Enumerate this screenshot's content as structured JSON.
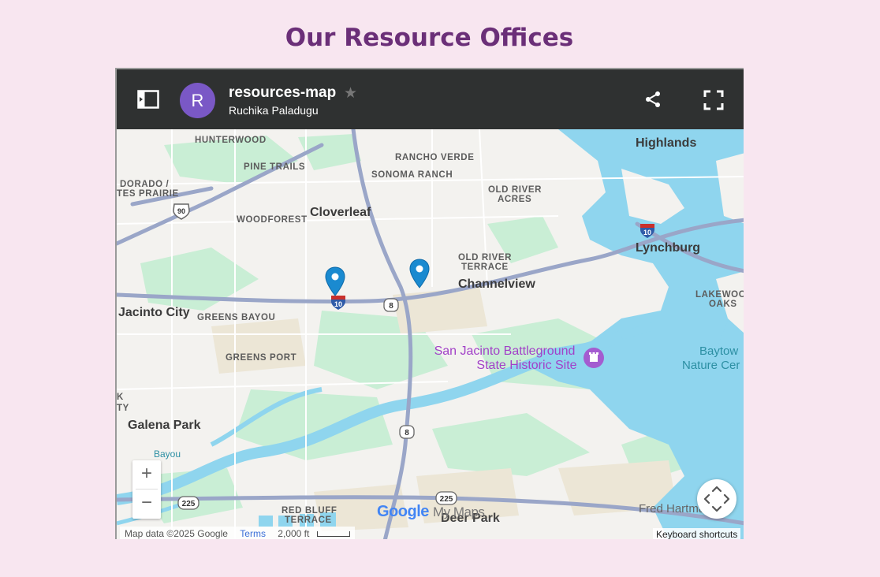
{
  "page": {
    "title": "Our Resource Offices"
  },
  "map_header": {
    "map_name": "resources-map",
    "owner": "Ruchika Paladugu",
    "avatar_letter": "R",
    "avatar_color": "#7a58c6",
    "star_icon": "star-icon",
    "share_icon": "share-icon",
    "fullscreen_icon": "fullscreen-icon",
    "sidebar_icon": "sidebar-toggle-icon"
  },
  "map": {
    "labels": {
      "hunterwood": "HUNTERWOOD",
      "pine_trails": "PINE TRAILS",
      "rancho_verde": "RANCHO VERDE",
      "sonoma_ranch": "SONOMA RANCH",
      "highlands": "Highlands",
      "dorado": "DORADO /",
      "tes_prairie": "TES PRAIRIE",
      "old_river_acres_1": "OLD RIVER",
      "old_river_acres_2": "ACRES",
      "woodforest": "WOODFOREST",
      "cloverleaf": "Cloverleaf",
      "lynchburg": "Lynchburg",
      "old_river_terrace_1": "OLD RIVER",
      "old_river_terrace_2": "TERRACE",
      "channelview": "Channelview",
      "lakewood_oaks_1": "LAKEWOOD",
      "lakewood_oaks_2": "OAKS",
      "jacinto_city": "Jacinto City",
      "greens_bayou": "GREENS BAYOU",
      "san_jacinto_1": "San Jacinto Battleground",
      "san_jacinto_2": "State Historic Site",
      "baytown_1": "Baytow",
      "baytown_2": "Nature Cer",
      "greens_port": "GREENS PORT",
      "k": "K",
      "ty": "TY",
      "galena_park": "Galena Park",
      "bayou": "Bayou",
      "red_bluff_1": "RED BLUFF",
      "red_bluff_2": "TERRACE",
      "deer_park": "Deer Park",
      "fred_hartman": "Fred Hartman Bri"
    },
    "shields": {
      "us90": "90",
      "i10_west": "10",
      "i10_east": "10",
      "sh8_north": "8",
      "sh8_south": "8",
      "sh225_west": "225",
      "sh225_east": "225"
    },
    "markers": [
      "office-marker-1",
      "office-marker-2"
    ],
    "zoom_in": "+",
    "zoom_out": "−",
    "attribution": "Map data ©2025 Google",
    "terms": "Terms",
    "scale": "2,000 ft",
    "keyboard_shortcuts": "Keyboard shortcuts",
    "logo_google": "Google",
    "logo_mymaps": "My Maps"
  },
  "colors": {
    "background": "#f8e6f0",
    "title": "#6b2f78",
    "header_bar": "#2f3131",
    "water": "#8fd5ee",
    "park": "#c6edd2",
    "highway": "#9aa6c8",
    "marker": "#1a8ad0"
  }
}
